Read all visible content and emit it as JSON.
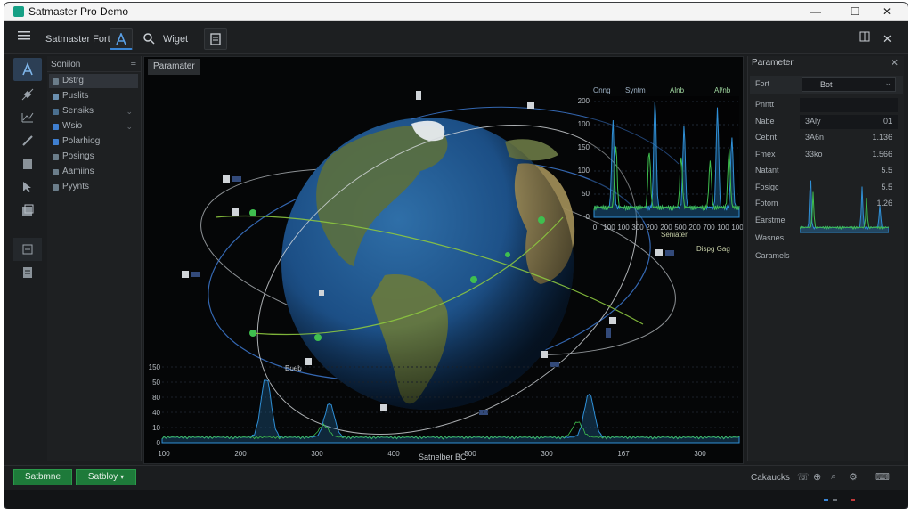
{
  "window": {
    "title": "Satmaster Pro Demo"
  },
  "toolbar": {
    "title": "Satmaster Fort",
    "item_widget": "Wiget"
  },
  "sidebar": {
    "header": "Sonilon",
    "items": [
      {
        "label": "Dstrg",
        "color": "#6b7d8a",
        "chevron": ""
      },
      {
        "label": "Puslits",
        "color": "#6a8faf",
        "chevron": ""
      },
      {
        "label": "Sensiks",
        "color": "#4a6f8f",
        "chevron": "⌄"
      },
      {
        "label": "Wsio",
        "color": "#3f7fd0",
        "chevron": "⌄"
      },
      {
        "label": "Polarhiog",
        "color": "#3f7fd0",
        "chevron": ""
      },
      {
        "label": "Posings",
        "color": "#6b7d8a",
        "chevron": ""
      },
      {
        "label": "Aamiins",
        "color": "#6b7d8a",
        "chevron": ""
      },
      {
        "label": "Pyynts",
        "color": "#6b7d8a",
        "chevron": ""
      }
    ]
  },
  "viewport": {
    "tab": "Paramater",
    "top_chart_legend": [
      "Onng",
      "Syntm",
      "Alnb",
      "Al/nb"
    ],
    "top_chart_yticks": [
      "200",
      "100",
      "150",
      "100",
      "50",
      "0"
    ],
    "top_chart_xticks": [
      "0",
      "100",
      "100",
      "300",
      "200",
      "200",
      "500",
      "200",
      "700",
      "100",
      "100"
    ],
    "mid_legend": [
      "Seniater",
      "Dispg Gag"
    ],
    "bottom_chart_yticks": [
      "150",
      "50",
      "80",
      "40",
      "10",
      "0"
    ],
    "bottom_chart_xticks": [
      "100",
      "200",
      "300",
      "400",
      "500",
      "300",
      "167",
      "300"
    ],
    "bottom_caption": "Satnelber BC",
    "orbit_label": "Boeb"
  },
  "right_panel": {
    "header": "Parameter",
    "font_label": "Fort",
    "font_value": "Bot",
    "rows": [
      {
        "key": "Pnntt",
        "v1": "",
        "v2": ""
      },
      {
        "key": "Nabe",
        "v1": "3Aly",
        "v2": "01"
      },
      {
        "key": "Cebnt",
        "v1": "3A6n",
        "v2": "1.136"
      },
      {
        "key": "Fmex",
        "v1": "33ko",
        "v2": "1.566"
      },
      {
        "key": "Natant",
        "v1": "",
        "v2": "5.5"
      },
      {
        "key": "Fosigc",
        "v1": "",
        "v2": "5.5"
      },
      {
        "key": "Fotom",
        "v1": "",
        "v2": "1.26"
      },
      {
        "key": "Earstme",
        "v1": "",
        "v2": ""
      },
      {
        "key": "Wasnes",
        "v1": "",
        "v2": ""
      },
      {
        "key": "Caramels",
        "v1": "",
        "v2": ""
      }
    ]
  },
  "status": {
    "btn_left": "Satbmne",
    "btn_right": "Satbloy",
    "right_label": "Cakaucks"
  },
  "colors": {
    "accent_blue": "#2f6fb6",
    "accent_green": "#2ea043",
    "chart_blue": "#2f8fd6",
    "chart_green": "#3fbf4f"
  }
}
